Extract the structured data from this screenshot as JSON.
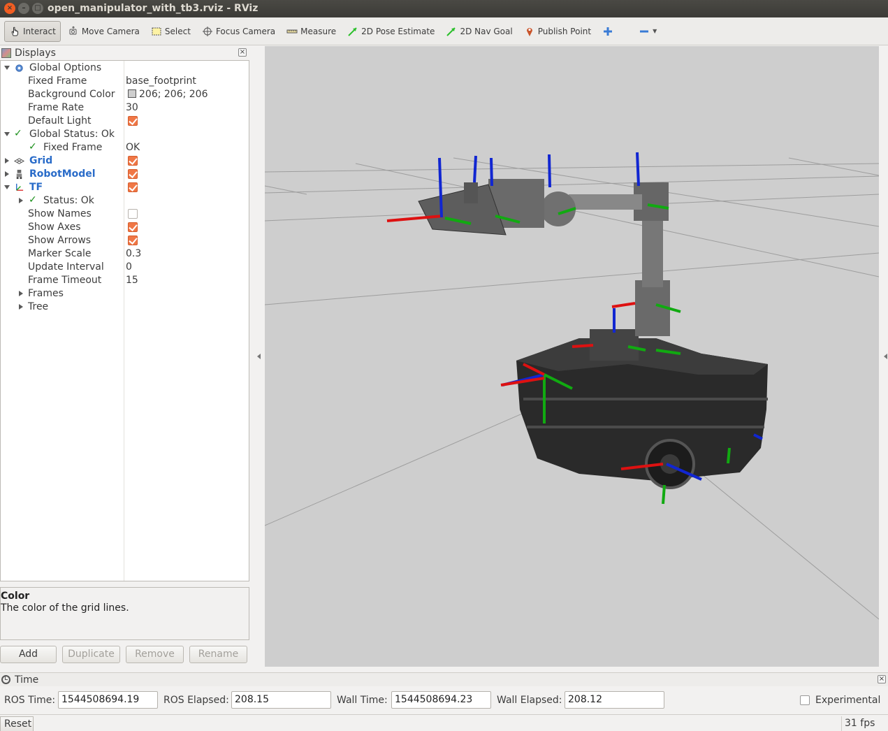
{
  "window": {
    "title": "open_manipulator_with_tb3.rviz - RViz"
  },
  "toolbar": {
    "items": [
      {
        "label": "Interact",
        "icon": "hand-pointer-icon",
        "active": true
      },
      {
        "label": "Move Camera",
        "icon": "move-camera-icon"
      },
      {
        "label": "Select",
        "icon": "select-rect-icon"
      },
      {
        "label": "Focus Camera",
        "icon": "focus-camera-icon"
      },
      {
        "label": "Measure",
        "icon": "ruler-icon"
      },
      {
        "label": "2D Pose Estimate",
        "icon": "green-arrow-icon"
      },
      {
        "label": "2D Nav Goal",
        "icon": "green-arrow-icon"
      },
      {
        "label": "Publish Point",
        "icon": "map-pin-icon"
      }
    ],
    "add_tool": "plus-icon",
    "remove_tool": "minus-icon"
  },
  "displays": {
    "title": "Displays",
    "global_options": {
      "label": "Global Options",
      "fixed_frame_label": "Fixed Frame",
      "fixed_frame_value": "base_footprint",
      "background_color_label": "Background Color",
      "background_color_value": "206; 206; 206",
      "frame_rate_label": "Frame Rate",
      "frame_rate_value": "30",
      "default_light_label": "Default Light",
      "default_light_checked": true
    },
    "global_status": {
      "label": "Global Status: Ok",
      "fixed_frame_label": "Fixed Frame",
      "fixed_frame_value": "OK"
    },
    "grid": {
      "label": "Grid",
      "checked": true
    },
    "robot_model": {
      "label": "RobotModel",
      "checked": true
    },
    "tf": {
      "label": "TF",
      "checked": true,
      "status_label": "Status: Ok",
      "show_names_label": "Show Names",
      "show_names": false,
      "show_axes_label": "Show Axes",
      "show_axes": true,
      "show_arrows_label": "Show Arrows",
      "show_arrows": true,
      "marker_scale_label": "Marker Scale",
      "marker_scale_value": "0.3",
      "update_interval_label": "Update Interval",
      "update_interval_value": "0",
      "frame_timeout_label": "Frame Timeout",
      "frame_timeout_value": "15",
      "frames_label": "Frames",
      "tree_label": "Tree"
    },
    "description": {
      "title": "Color",
      "text": "The color of the grid lines."
    },
    "buttons": {
      "add": "Add",
      "duplicate": "Duplicate",
      "remove": "Remove",
      "rename": "Rename"
    }
  },
  "time": {
    "title": "Time",
    "ros_time_label": "ROS Time:",
    "ros_time_value": "1544508694.19",
    "ros_elapsed_label": "ROS Elapsed:",
    "ros_elapsed_value": "208.15",
    "wall_time_label": "Wall Time:",
    "wall_time_value": "1544508694.23",
    "wall_elapsed_label": "Wall Elapsed:",
    "wall_elapsed_value": "208.12",
    "experimental_label": "Experimental"
  },
  "status": {
    "reset_label": "Reset",
    "fps": "31 fps"
  },
  "colors": {
    "view_background": "#cecece",
    "accent_orange": "#f07746",
    "link_blue": "#2a6cc9"
  }
}
